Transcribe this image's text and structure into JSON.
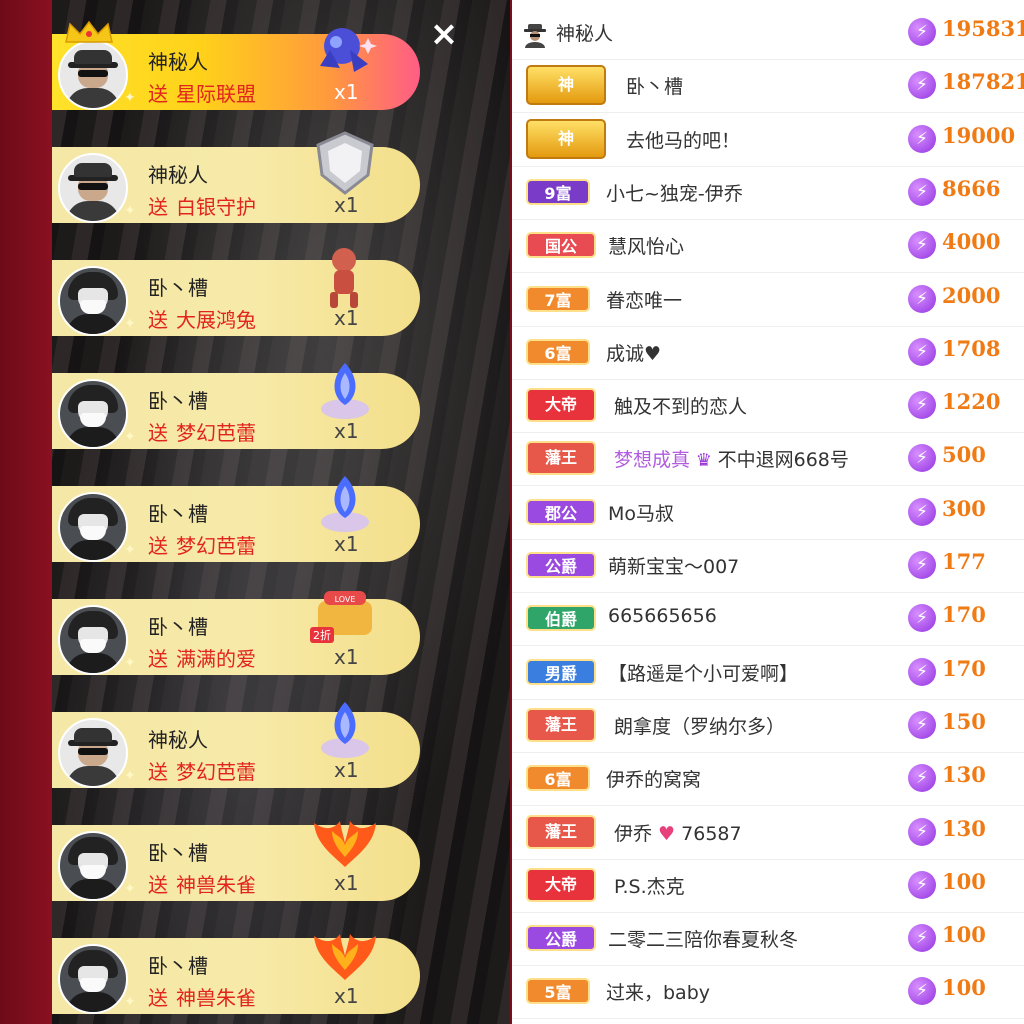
{
  "stream": {
    "close_label": "×",
    "gifts": [
      {
        "sender": "神秘人",
        "verb": "送",
        "gift": "星际联盟",
        "qty": "x1",
        "avatar": "anonymous",
        "highlight": true
      },
      {
        "sender": "神秘人",
        "verb": "送",
        "gift": "白银守护",
        "qty": "x1",
        "avatar": "anonymous"
      },
      {
        "sender": "卧丶槽",
        "verb": "送",
        "gift": "大展鸿兔",
        "qty": "x1",
        "avatar": "dark"
      },
      {
        "sender": "卧丶槽",
        "verb": "送",
        "gift": "梦幻芭蕾",
        "qty": "x1",
        "avatar": "dark"
      },
      {
        "sender": "卧丶槽",
        "verb": "送",
        "gift": "梦幻芭蕾",
        "qty": "x1",
        "avatar": "dark"
      },
      {
        "sender": "卧丶槽",
        "verb": "送",
        "gift": "满满的爱",
        "qty": "x1",
        "avatar": "dark",
        "gift_tag": "2折"
      },
      {
        "sender": "神秘人",
        "verb": "送",
        "gift": "梦幻芭蕾",
        "qty": "x1",
        "avatar": "anonymous"
      },
      {
        "sender": "卧丶槽",
        "verb": "送",
        "gift": "神兽朱雀",
        "qty": "x1",
        "avatar": "dark"
      },
      {
        "sender": "卧丶槽",
        "verb": "送",
        "gift": "神兽朱雀",
        "qty": "x1",
        "avatar": "dark"
      }
    ]
  },
  "ranking": {
    "rows": [
      {
        "badge": "",
        "name": "神秘人",
        "score": "195831",
        "badge_type": "anon"
      },
      {
        "badge": "神",
        "name": "卧丶槽",
        "score": "187821",
        "badge_type": "shen"
      },
      {
        "badge": "神",
        "name": "去他马的吧！",
        "score": "19000",
        "badge_type": "shen"
      },
      {
        "badge": "9富",
        "name": "小七~独宠-伊乔",
        "score": "8666",
        "badge_type": "fu9"
      },
      {
        "badge": "国公",
        "name": "慧风怡心",
        "score": "4000",
        "badge_type": "guogong"
      },
      {
        "badge": "7富",
        "name": "眷恋唯一",
        "score": "2000",
        "badge_type": "fu7"
      },
      {
        "badge": "6富",
        "name": "成诚♥",
        "score": "1708",
        "badge_type": "fu6"
      },
      {
        "badge": "大帝",
        "name": "触及不到的恋人",
        "score": "1220",
        "badge_type": "dadi"
      },
      {
        "badge": "藩王",
        "name": "不中退网668号",
        "score": "500",
        "badge_type": "fanwang",
        "prefix": "梦想成真"
      },
      {
        "badge": "郡公",
        "name": "Mo马叔",
        "score": "300",
        "badge_type": "jungong"
      },
      {
        "badge": "公爵",
        "name": "萌新宝宝～007",
        "score": "177",
        "badge_type": "gongjue"
      },
      {
        "badge": "伯爵",
        "name": "665665656",
        "score": "170",
        "badge_type": "bojue"
      },
      {
        "badge": "男爵",
        "name": "【路遥是个小可爱啊】",
        "score": "170",
        "badge_type": "nanjue"
      },
      {
        "badge": "藩王",
        "name": "朗拿度（罗纳尔多）",
        "score": "150",
        "badge_type": "fanwang"
      },
      {
        "badge": "6富",
        "name": "伊乔的窝窝",
        "score": "130",
        "badge_type": "fu6"
      },
      {
        "badge": "藩王",
        "name": "76587",
        "score": "130",
        "badge_type": "fanwang",
        "name_prefix": "伊乔"
      },
      {
        "badge": "大帝",
        "name": "P.S.杰克",
        "score": "100",
        "badge_type": "dadi"
      },
      {
        "badge": "公爵",
        "name": "二零二三陪你春夏秋冬",
        "score": "100",
        "badge_type": "gongjue"
      },
      {
        "badge": "5富",
        "name": "过来，baby",
        "score": "100",
        "badge_type": "fu5"
      }
    ]
  },
  "colors": {
    "accent": "#f07a14",
    "gift_text": "#e2241e",
    "bolt": "#9233e0"
  }
}
